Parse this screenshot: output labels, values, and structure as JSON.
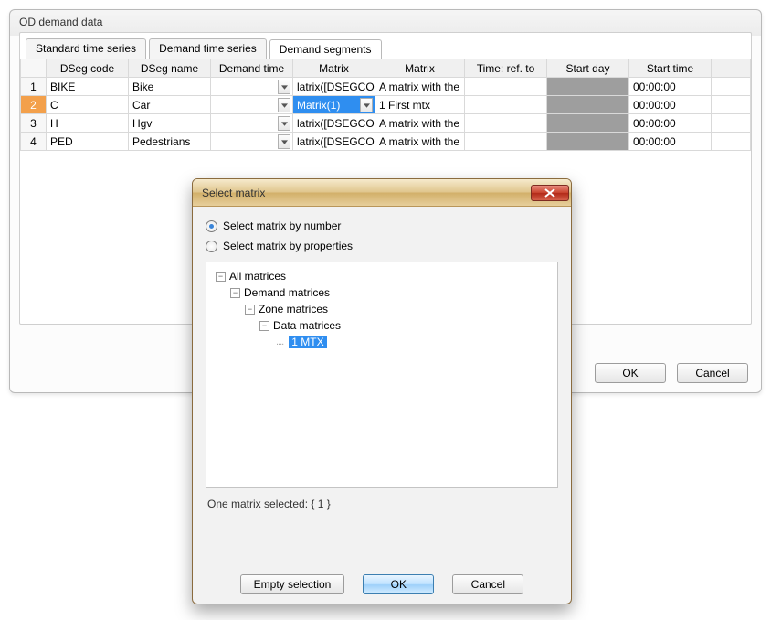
{
  "main_window": {
    "title": "OD demand data",
    "tabs": [
      {
        "label": "Standard time series",
        "active": false
      },
      {
        "label": "Demand time series",
        "active": false
      },
      {
        "label": "Demand segments",
        "active": true
      }
    ],
    "columns": [
      "DSeg code",
      "DSeg name",
      "Demand time",
      "Matrix",
      "Matrix",
      "Time: ref. to",
      "Start day",
      "Start time"
    ],
    "rows": [
      {
        "n": "1",
        "code": "BIKE",
        "name": "Bike",
        "demand_time": "",
        "mx1": "latrix([DSEGCODE",
        "mx2": "A matrix with the",
        "ref": "",
        "day": "",
        "time": "00:00:00"
      },
      {
        "n": "2",
        "code": "C",
        "name": "Car",
        "demand_time": "",
        "mx1": "Matrix(1)",
        "mx2": "1 First mtx",
        "ref": "",
        "day": "",
        "time": "00:00:00",
        "selected": true
      },
      {
        "n": "3",
        "code": "H",
        "name": "Hgv",
        "demand_time": "",
        "mx1": "latrix([DSEGCODE",
        "mx2": "A matrix with the",
        "ref": "",
        "day": "",
        "time": "00:00:00"
      },
      {
        "n": "4",
        "code": "PED",
        "name": "Pedestrians",
        "demand_time": "",
        "mx1": "latrix([DSEGCODE",
        "mx2": "A matrix with the",
        "ref": "",
        "day": "",
        "time": "00:00:00"
      }
    ],
    "ok_label": "OK",
    "cancel_label": "Cancel"
  },
  "modal": {
    "title": "Select matrix",
    "radio_by_number": "Select matrix by number",
    "radio_by_properties": "Select matrix by properties",
    "tree": {
      "root": "All matrices",
      "l1": "Demand matrices",
      "l2": "Zone matrices",
      "l3": "Data matrices",
      "leaf": "1 MTX"
    },
    "status": "One matrix selected: { 1 }",
    "empty_label": "Empty selection",
    "ok_label": "OK",
    "cancel_label": "Cancel"
  }
}
